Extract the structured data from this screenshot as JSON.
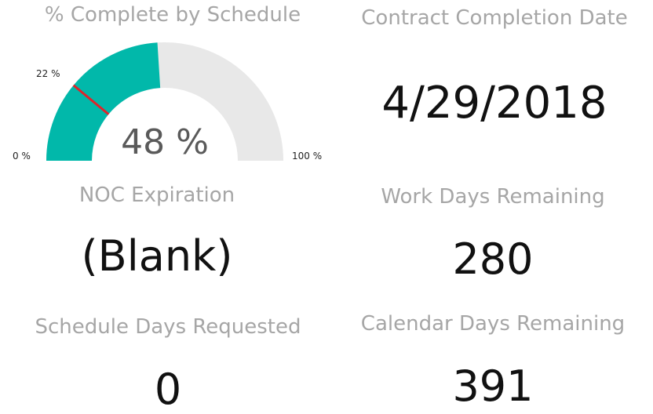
{
  "gauge": {
    "title": "% Complete by Schedule",
    "value_pct": 48,
    "target_pct": 22,
    "min_label": "0 %",
    "max_label": "100 %",
    "target_label": "22 %",
    "center_label": "48 %",
    "fill_color": "#01b8aa",
    "track_color": "#e8e8e8",
    "target_color": "#e0242b"
  },
  "cards": {
    "contract_completion": {
      "title": "Contract Completion Date",
      "value": "4/29/2018"
    },
    "noc_expiration": {
      "title": "NOC Expiration",
      "value": "(Blank)"
    },
    "work_days_remaining": {
      "title": "Work Days Remaining",
      "value": "280"
    },
    "schedule_days_requested": {
      "title": "Schedule Days Requested",
      "value": "0"
    },
    "calendar_days_remaining": {
      "title": "Calendar Days Remaining",
      "value": "391"
    }
  }
}
